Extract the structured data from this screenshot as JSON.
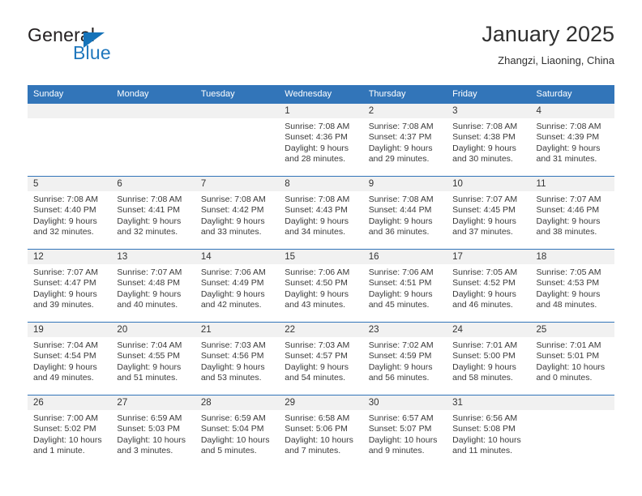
{
  "brand": {
    "name_part1": "General",
    "name_part2": "Blue",
    "accent_color": "#1673b9"
  },
  "header": {
    "title": "January 2025",
    "subtitle": "Zhangzi, Liaoning, China"
  },
  "theme": {
    "header_row_color": "#3275b9",
    "daynum_strip_color": "#f1f1f1",
    "text_color": "#3a3a3a"
  },
  "weekday_headers": [
    "Sunday",
    "Monday",
    "Tuesday",
    "Wednesday",
    "Thursday",
    "Friday",
    "Saturday"
  ],
  "labels": {
    "sunrise_prefix": "Sunrise:",
    "sunset_prefix": "Sunset:",
    "daylight_prefix": "Daylight:"
  },
  "weeks": [
    [
      {
        "day": "",
        "blank": true
      },
      {
        "day": "",
        "blank": true
      },
      {
        "day": "",
        "blank": true
      },
      {
        "day": "1",
        "sunrise": "Sunrise: 7:08 AM",
        "sunset": "Sunset: 4:36 PM",
        "daylight1": "Daylight: 9 hours",
        "daylight2": "and 28 minutes."
      },
      {
        "day": "2",
        "sunrise": "Sunrise: 7:08 AM",
        "sunset": "Sunset: 4:37 PM",
        "daylight1": "Daylight: 9 hours",
        "daylight2": "and 29 minutes."
      },
      {
        "day": "3",
        "sunrise": "Sunrise: 7:08 AM",
        "sunset": "Sunset: 4:38 PM",
        "daylight1": "Daylight: 9 hours",
        "daylight2": "and 30 minutes."
      },
      {
        "day": "4",
        "sunrise": "Sunrise: 7:08 AM",
        "sunset": "Sunset: 4:39 PM",
        "daylight1": "Daylight: 9 hours",
        "daylight2": "and 31 minutes."
      }
    ],
    [
      {
        "day": "5",
        "sunrise": "Sunrise: 7:08 AM",
        "sunset": "Sunset: 4:40 PM",
        "daylight1": "Daylight: 9 hours",
        "daylight2": "and 32 minutes."
      },
      {
        "day": "6",
        "sunrise": "Sunrise: 7:08 AM",
        "sunset": "Sunset: 4:41 PM",
        "daylight1": "Daylight: 9 hours",
        "daylight2": "and 32 minutes."
      },
      {
        "day": "7",
        "sunrise": "Sunrise: 7:08 AM",
        "sunset": "Sunset: 4:42 PM",
        "daylight1": "Daylight: 9 hours",
        "daylight2": "and 33 minutes."
      },
      {
        "day": "8",
        "sunrise": "Sunrise: 7:08 AM",
        "sunset": "Sunset: 4:43 PM",
        "daylight1": "Daylight: 9 hours",
        "daylight2": "and 34 minutes."
      },
      {
        "day": "9",
        "sunrise": "Sunrise: 7:08 AM",
        "sunset": "Sunset: 4:44 PM",
        "daylight1": "Daylight: 9 hours",
        "daylight2": "and 36 minutes."
      },
      {
        "day": "10",
        "sunrise": "Sunrise: 7:07 AM",
        "sunset": "Sunset: 4:45 PM",
        "daylight1": "Daylight: 9 hours",
        "daylight2": "and 37 minutes."
      },
      {
        "day": "11",
        "sunrise": "Sunrise: 7:07 AM",
        "sunset": "Sunset: 4:46 PM",
        "daylight1": "Daylight: 9 hours",
        "daylight2": "and 38 minutes."
      }
    ],
    [
      {
        "day": "12",
        "sunrise": "Sunrise: 7:07 AM",
        "sunset": "Sunset: 4:47 PM",
        "daylight1": "Daylight: 9 hours",
        "daylight2": "and 39 minutes."
      },
      {
        "day": "13",
        "sunrise": "Sunrise: 7:07 AM",
        "sunset": "Sunset: 4:48 PM",
        "daylight1": "Daylight: 9 hours",
        "daylight2": "and 40 minutes."
      },
      {
        "day": "14",
        "sunrise": "Sunrise: 7:06 AM",
        "sunset": "Sunset: 4:49 PM",
        "daylight1": "Daylight: 9 hours",
        "daylight2": "and 42 minutes."
      },
      {
        "day": "15",
        "sunrise": "Sunrise: 7:06 AM",
        "sunset": "Sunset: 4:50 PM",
        "daylight1": "Daylight: 9 hours",
        "daylight2": "and 43 minutes."
      },
      {
        "day": "16",
        "sunrise": "Sunrise: 7:06 AM",
        "sunset": "Sunset: 4:51 PM",
        "daylight1": "Daylight: 9 hours",
        "daylight2": "and 45 minutes."
      },
      {
        "day": "17",
        "sunrise": "Sunrise: 7:05 AM",
        "sunset": "Sunset: 4:52 PM",
        "daylight1": "Daylight: 9 hours",
        "daylight2": "and 46 minutes."
      },
      {
        "day": "18",
        "sunrise": "Sunrise: 7:05 AM",
        "sunset": "Sunset: 4:53 PM",
        "daylight1": "Daylight: 9 hours",
        "daylight2": "and 48 minutes."
      }
    ],
    [
      {
        "day": "19",
        "sunrise": "Sunrise: 7:04 AM",
        "sunset": "Sunset: 4:54 PM",
        "daylight1": "Daylight: 9 hours",
        "daylight2": "and 49 minutes."
      },
      {
        "day": "20",
        "sunrise": "Sunrise: 7:04 AM",
        "sunset": "Sunset: 4:55 PM",
        "daylight1": "Daylight: 9 hours",
        "daylight2": "and 51 minutes."
      },
      {
        "day": "21",
        "sunrise": "Sunrise: 7:03 AM",
        "sunset": "Sunset: 4:56 PM",
        "daylight1": "Daylight: 9 hours",
        "daylight2": "and 53 minutes."
      },
      {
        "day": "22",
        "sunrise": "Sunrise: 7:03 AM",
        "sunset": "Sunset: 4:57 PM",
        "daylight1": "Daylight: 9 hours",
        "daylight2": "and 54 minutes."
      },
      {
        "day": "23",
        "sunrise": "Sunrise: 7:02 AM",
        "sunset": "Sunset: 4:59 PM",
        "daylight1": "Daylight: 9 hours",
        "daylight2": "and 56 minutes."
      },
      {
        "day": "24",
        "sunrise": "Sunrise: 7:01 AM",
        "sunset": "Sunset: 5:00 PM",
        "daylight1": "Daylight: 9 hours",
        "daylight2": "and 58 minutes."
      },
      {
        "day": "25",
        "sunrise": "Sunrise: 7:01 AM",
        "sunset": "Sunset: 5:01 PM",
        "daylight1": "Daylight: 10 hours",
        "daylight2": "and 0 minutes."
      }
    ],
    [
      {
        "day": "26",
        "sunrise": "Sunrise: 7:00 AM",
        "sunset": "Sunset: 5:02 PM",
        "daylight1": "Daylight: 10 hours",
        "daylight2": "and 1 minute."
      },
      {
        "day": "27",
        "sunrise": "Sunrise: 6:59 AM",
        "sunset": "Sunset: 5:03 PM",
        "daylight1": "Daylight: 10 hours",
        "daylight2": "and 3 minutes."
      },
      {
        "day": "28",
        "sunrise": "Sunrise: 6:59 AM",
        "sunset": "Sunset: 5:04 PM",
        "daylight1": "Daylight: 10 hours",
        "daylight2": "and 5 minutes."
      },
      {
        "day": "29",
        "sunrise": "Sunrise: 6:58 AM",
        "sunset": "Sunset: 5:06 PM",
        "daylight1": "Daylight: 10 hours",
        "daylight2": "and 7 minutes."
      },
      {
        "day": "30",
        "sunrise": "Sunrise: 6:57 AM",
        "sunset": "Sunset: 5:07 PM",
        "daylight1": "Daylight: 10 hours",
        "daylight2": "and 9 minutes."
      },
      {
        "day": "31",
        "sunrise": "Sunrise: 6:56 AM",
        "sunset": "Sunset: 5:08 PM",
        "daylight1": "Daylight: 10 hours",
        "daylight2": "and 11 minutes."
      },
      {
        "day": "",
        "blank": true
      }
    ]
  ]
}
